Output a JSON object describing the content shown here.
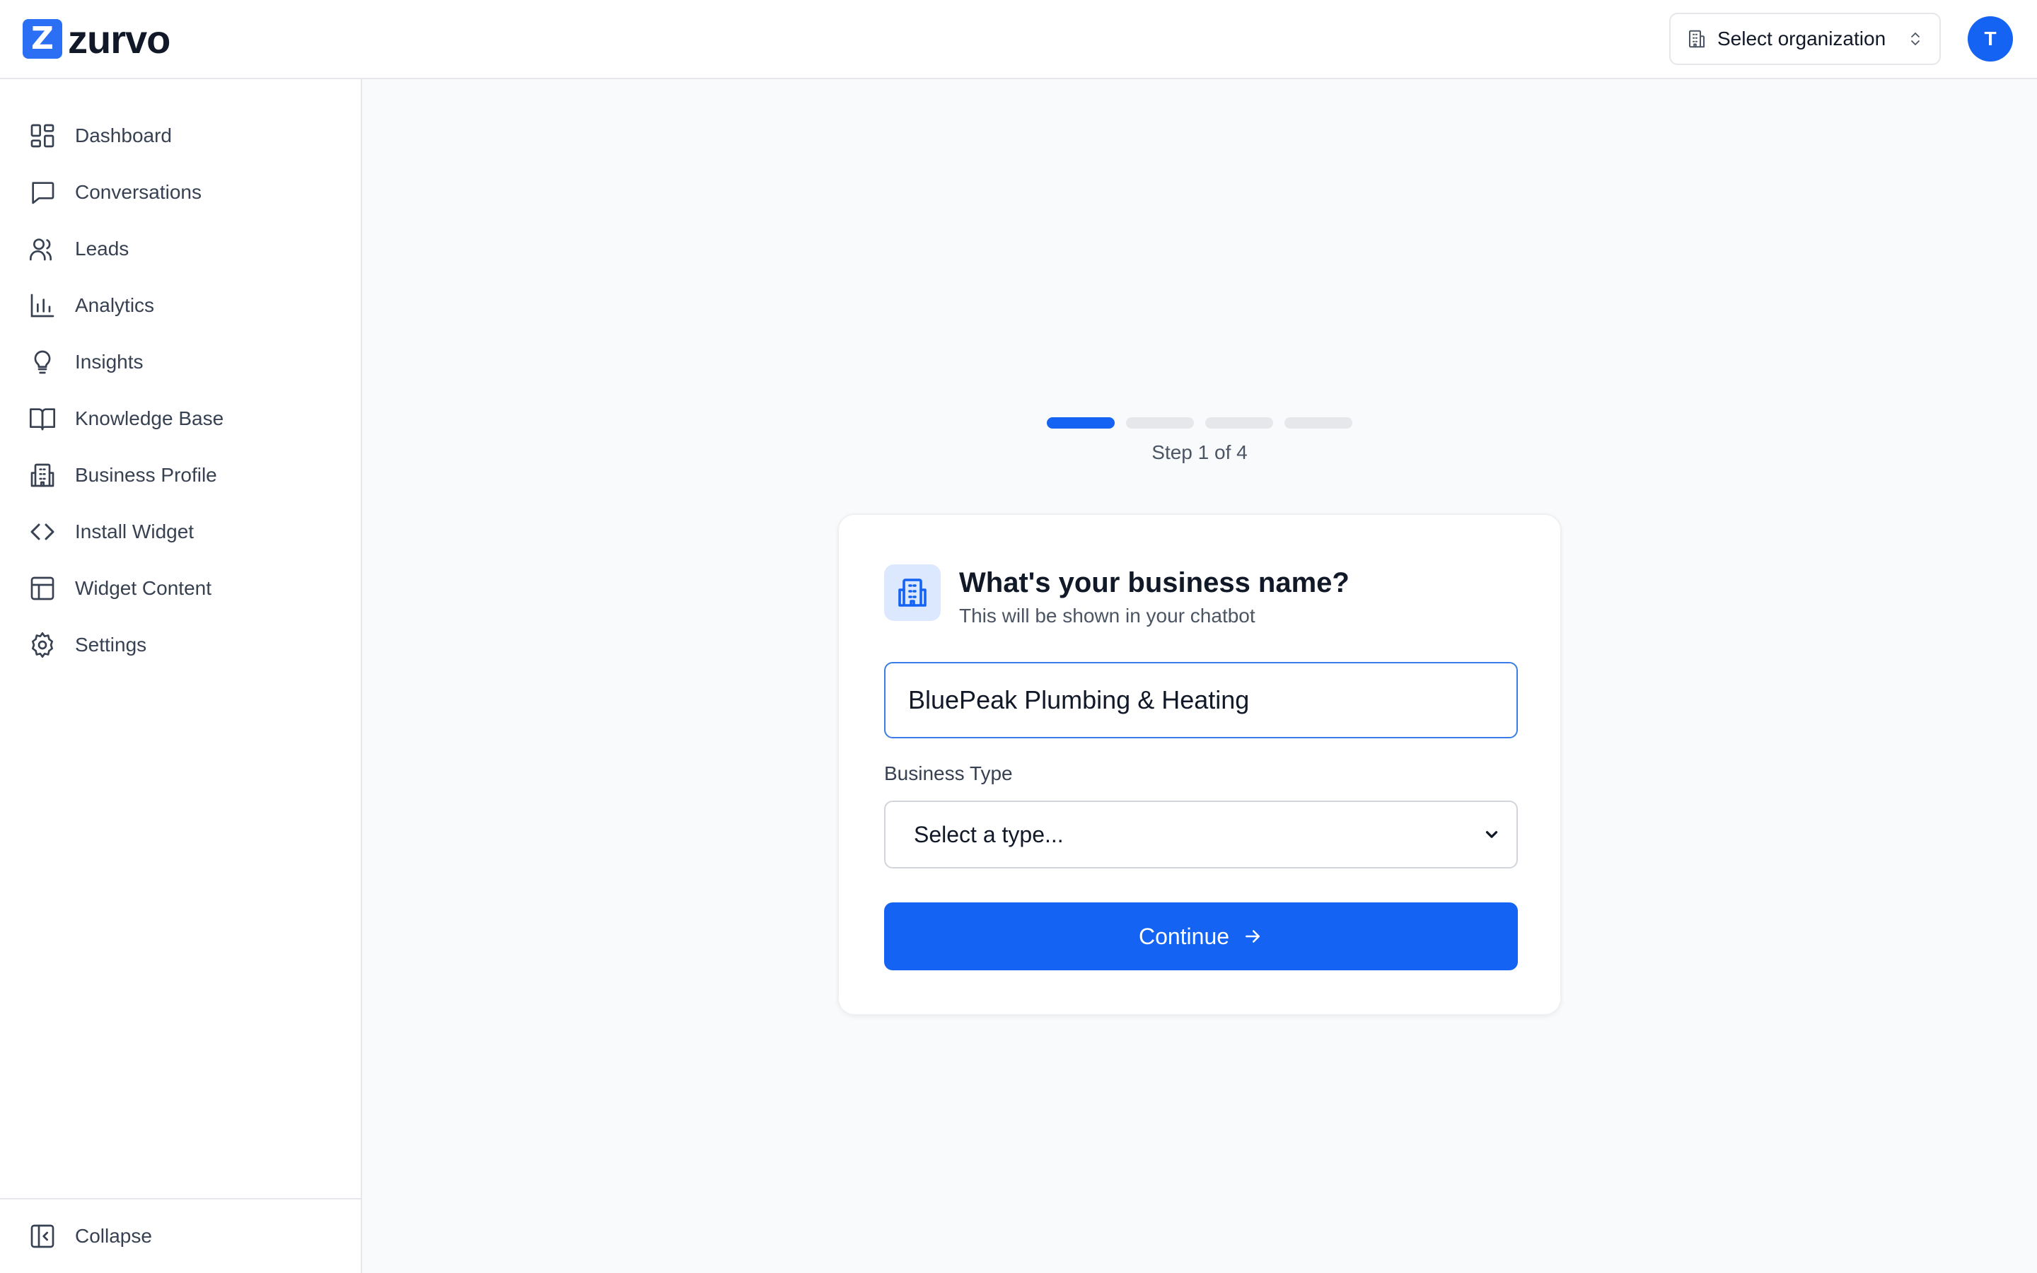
{
  "app": {
    "name": "zurvo",
    "logo_letter": "Z",
    "accent": "#1463f3"
  },
  "header": {
    "org_select_label": "Select organization",
    "avatar_initial": "T"
  },
  "sidebar": {
    "items": [
      {
        "label": "Dashboard",
        "icon": "dashboard-icon"
      },
      {
        "label": "Conversations",
        "icon": "chat-bubble-icon"
      },
      {
        "label": "Leads",
        "icon": "users-icon"
      },
      {
        "label": "Analytics",
        "icon": "bar-chart-icon"
      },
      {
        "label": "Insights",
        "icon": "lightbulb-icon"
      },
      {
        "label": "Knowledge Base",
        "icon": "book-icon"
      },
      {
        "label": "Business Profile",
        "icon": "building-icon"
      },
      {
        "label": "Install Widget",
        "icon": "code-icon"
      },
      {
        "label": "Widget Content",
        "icon": "layout-icon"
      },
      {
        "label": "Settings",
        "icon": "gear-icon"
      }
    ],
    "collapse_label": "Collapse"
  },
  "onboarding": {
    "current_step": 1,
    "total_steps": 4,
    "step_text": "Step 1 of 4",
    "title": "What's your business name?",
    "subtitle": "This will be shown in your chatbot",
    "name_value": "BluePeak Plumbing & Heating",
    "type_label": "Business Type",
    "type_selected": "Select a type...",
    "continue_label": "Continue"
  }
}
